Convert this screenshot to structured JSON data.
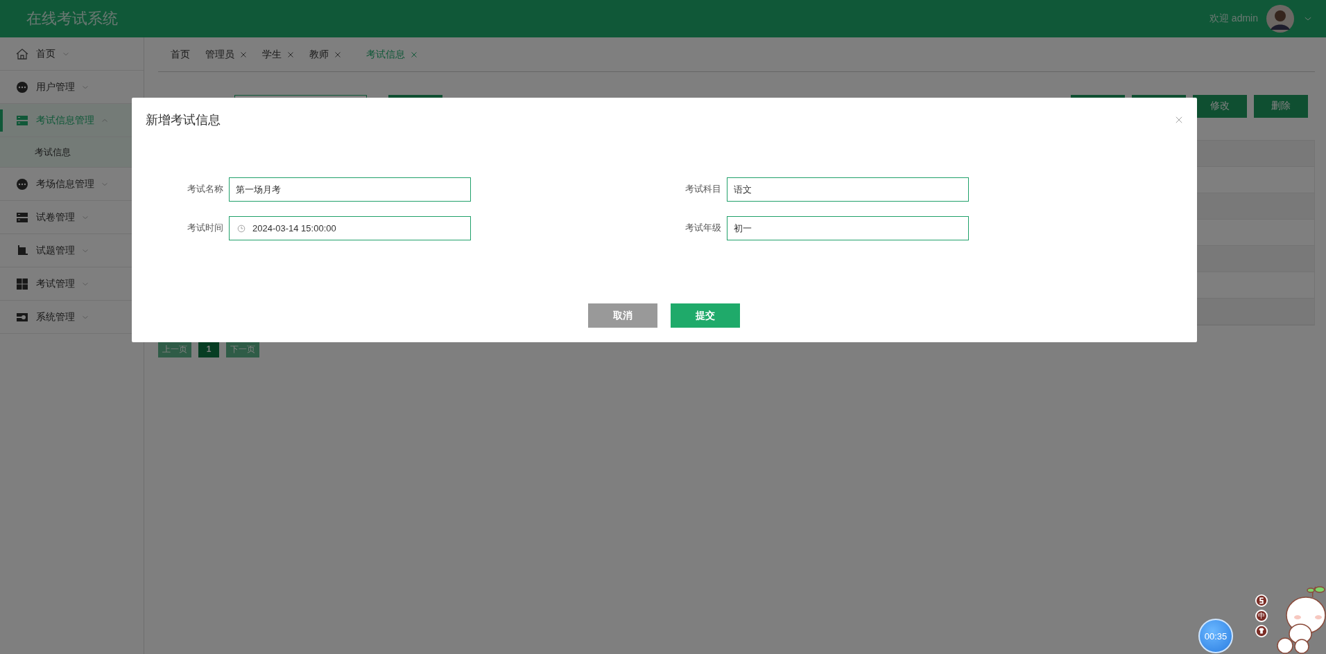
{
  "header": {
    "title": "在线考试系统",
    "greeting": "欢迎 admin"
  },
  "sidebar": {
    "items": [
      {
        "label": "首页",
        "expanded": false,
        "selected": false
      },
      {
        "label": "用户管理",
        "expanded": false,
        "selected": false
      },
      {
        "label": "考试信息管理",
        "expanded": true,
        "selected": true,
        "children": [
          {
            "label": "考试信息",
            "selected": false
          }
        ]
      },
      {
        "label": "考场信息管理",
        "expanded": false,
        "selected": false
      },
      {
        "label": "试卷管理",
        "expanded": false,
        "selected": false
      },
      {
        "label": "试题管理",
        "expanded": false,
        "selected": false
      },
      {
        "label": "考试管理",
        "expanded": false,
        "selected": false
      },
      {
        "label": "系统管理",
        "expanded": false,
        "selected": false
      }
    ]
  },
  "tabs": [
    {
      "label": "首页",
      "closable": false,
      "selected": false
    },
    {
      "label": "管理员",
      "closable": true,
      "selected": false
    },
    {
      "label": "学生",
      "closable": true,
      "selected": false
    },
    {
      "label": "教师",
      "closable": true,
      "selected": false
    },
    {
      "label": "考试信息",
      "closable": true,
      "selected": true
    }
  ],
  "toolbar": {
    "buttons": [
      "修改",
      "删除"
    ]
  },
  "pagination": {
    "prev": {
      "label": "上一页",
      "disabled": true
    },
    "pages": [
      {
        "label": "1",
        "selected": true
      }
    ],
    "next": {
      "label": "下一页",
      "disabled": true
    }
  },
  "dialog": {
    "title": "新增考试信息",
    "fields": [
      {
        "label": "考试名称",
        "value": "第一场月考",
        "kind": "text"
      },
      {
        "label": "考试科目",
        "value": "语文",
        "kind": "text"
      },
      {
        "label": "考试时间",
        "value": "2024-03-14 15:00:00",
        "kind": "datetime"
      },
      {
        "label": "考试年级",
        "value": "初一",
        "kind": "text"
      }
    ],
    "buttons": [
      {
        "label": "取消",
        "kind": "cancel"
      },
      {
        "label": "提交",
        "kind": "submit"
      }
    ]
  },
  "floating": {
    "timer": "00:35",
    "ime_label": "中"
  }
}
